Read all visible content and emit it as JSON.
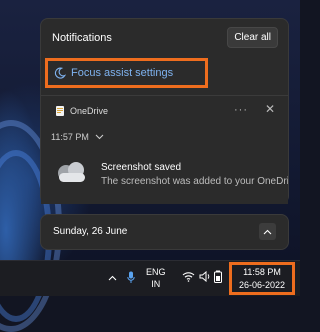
{
  "notifications": {
    "title": "Notifications",
    "clear_all_label": "Clear all",
    "focus_assist_label": "Focus assist settings"
  },
  "notification_card": {
    "app_name": "OneDrive",
    "more_label": "···",
    "close_label": "✕",
    "time": "11:57 PM",
    "title": "Screenshot saved",
    "body": "The screenshot was added to your OneDrive."
  },
  "calendar": {
    "date_label": "Sunday, 26 June"
  },
  "taskbar": {
    "language_line1": "ENG",
    "language_line2": "IN",
    "clock_time": "11:58 PM",
    "clock_date": "26-06-2022"
  },
  "colors": {
    "highlight": "#ee6d1e",
    "link": "#7fb3f0",
    "panel_bg": "#2b2b2b"
  },
  "icons": [
    "moon-icon",
    "onedrive-icon",
    "more-icon",
    "close-icon",
    "chevron-down-icon",
    "cloud-icon",
    "chevron-up-icon",
    "show-hidden-icons",
    "microphone-icon",
    "wifi-icon",
    "speaker-icon",
    "battery-icon"
  ]
}
